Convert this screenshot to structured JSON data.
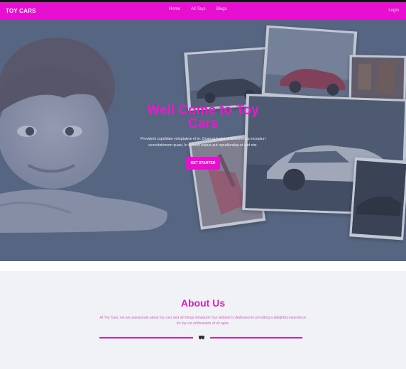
{
  "navbar": {
    "brand": "TOY CARS",
    "links": [
      "Home",
      "All Toys",
      "Blogs"
    ],
    "right_link": "Login"
  },
  "hero": {
    "title": "Well Come to Toy Cars",
    "description": "Provident cupiditate voluptatem et in. Quaerat fugiat ut assumenda excepturi exercitationem quasi. In deleniti eaque aut repudiandae et a id nisi.",
    "cta_label": "GET STARTED"
  },
  "about": {
    "title": "About Us",
    "text": "At Toy Cars, we are passionate about toy cars and all things miniature! Our website is dedicated to providing a delightful experience for toy car enthusiasts of all ages."
  },
  "colors": {
    "brand": "#e810d0",
    "hero_overlay": "#5a6882",
    "about_bg": "#f1f2f5"
  }
}
